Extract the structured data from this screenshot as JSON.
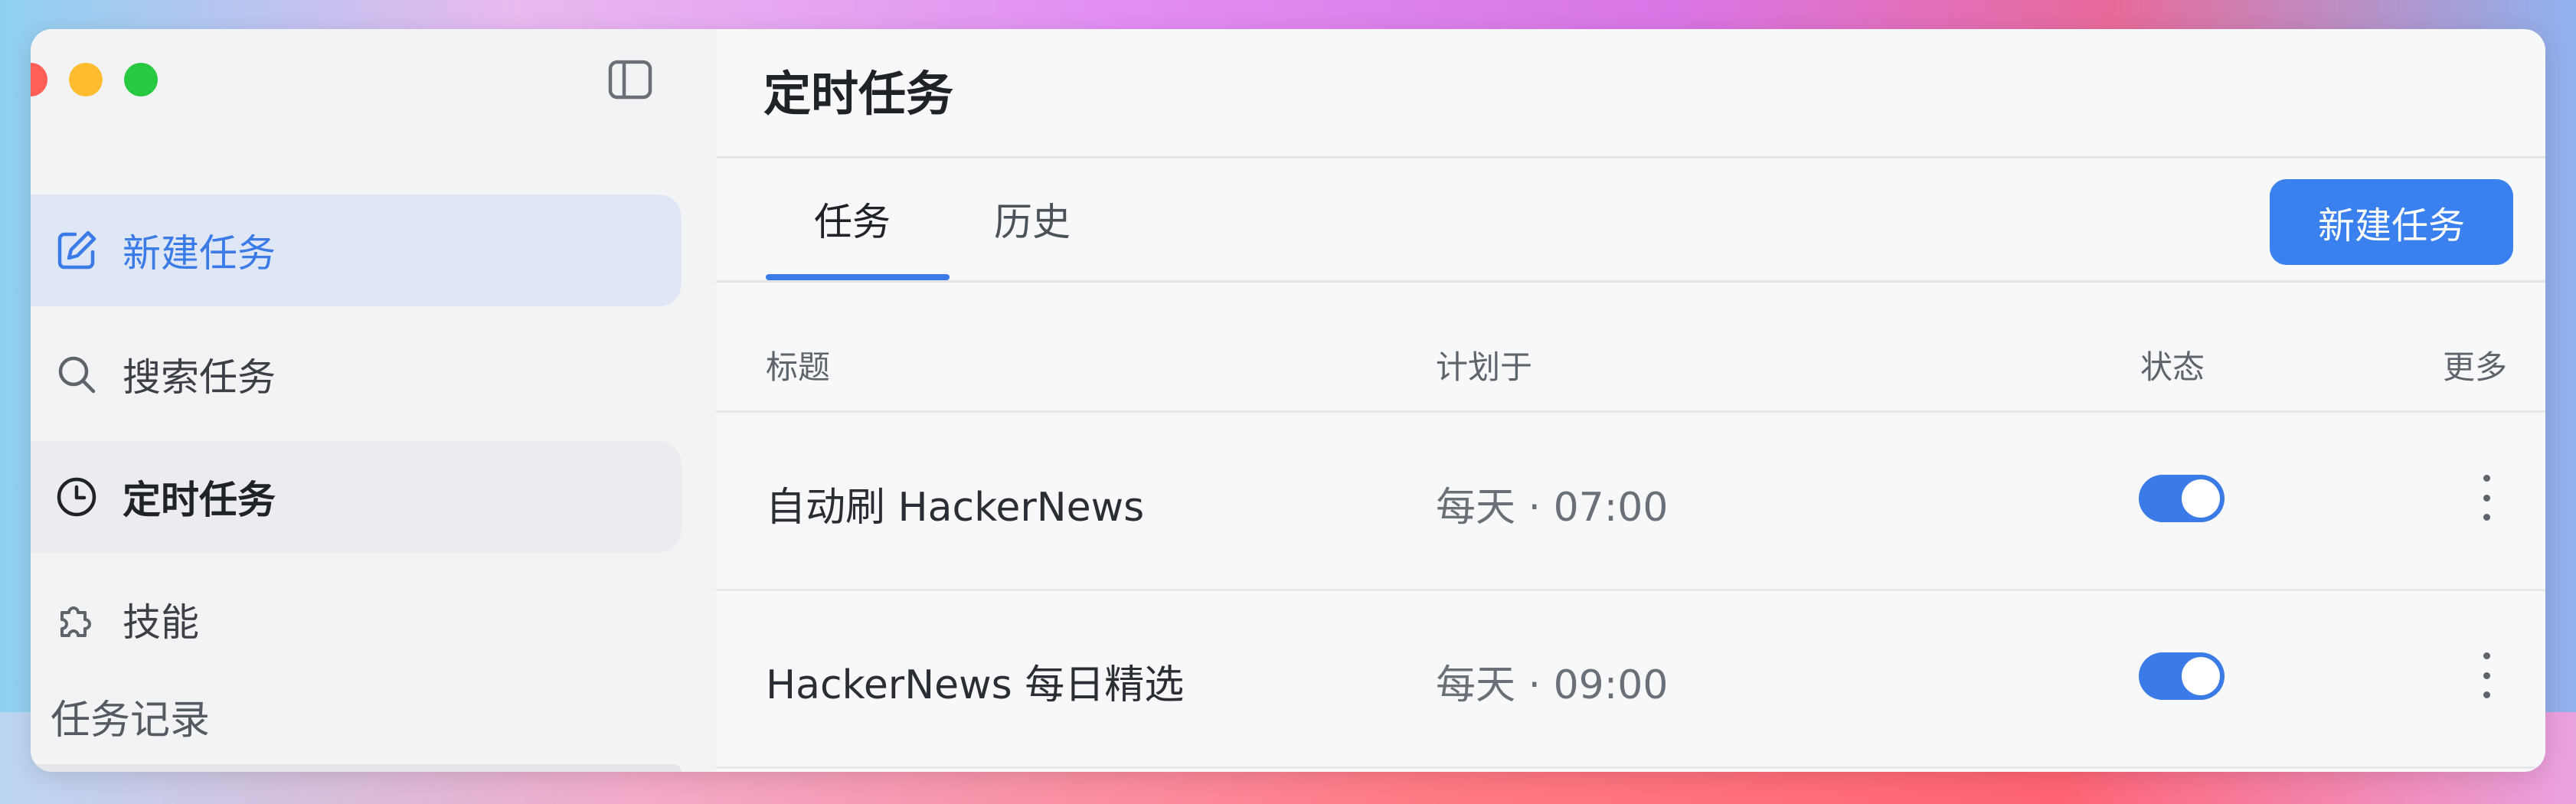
{
  "sidebar": {
    "items": [
      {
        "label": "新建任务",
        "icon": "edit-icon",
        "state": "active"
      },
      {
        "label": "搜索任务",
        "icon": "search-icon",
        "state": "normal"
      },
      {
        "label": "定时任务",
        "icon": "clock-icon",
        "state": "hover"
      },
      {
        "label": "技能",
        "icon": "puzzle-icon",
        "state": "normal"
      }
    ],
    "records_label": "任务记录"
  },
  "main": {
    "title": "定时任务",
    "tabs": [
      {
        "label": "任务",
        "active": true
      },
      {
        "label": "历史",
        "active": false
      }
    ],
    "new_button_label": "新建任务",
    "table": {
      "columns": [
        "标题",
        "计划于",
        "状态",
        "更多"
      ],
      "rows": [
        {
          "title": "自动刷 HackerNews",
          "schedule": "每天 · 07:00",
          "enabled": true
        },
        {
          "title": "HackerNews 每日精选",
          "schedule": "每天 · 09:00",
          "enabled": true
        }
      ]
    }
  },
  "colors": {
    "accent": "#3b7be8",
    "active_bg": "#dfe7f6",
    "sidebar_bg": "#f2f3f5",
    "main_bg": "#f7f8fa"
  }
}
